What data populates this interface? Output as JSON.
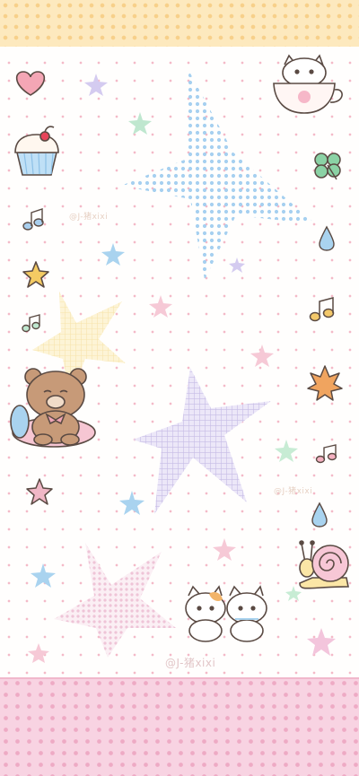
{
  "wallpaper": {
    "watermarks": [
      "@J-猪xixi",
      "@J-猪xixi",
      "@J-猪xixi"
    ],
    "palette": {
      "top_band": "#fde9be",
      "bottom_band": "#f8d3e2",
      "dot": "#f4b9c8",
      "blue_star": "#a9d3ef",
      "lavender_star": "#c9bfe6",
      "yellow_star": "#fbeab8",
      "pink_star": "#eec1d5"
    },
    "stickers": [
      "heart-icon",
      "cupcake-icon",
      "music-note-icon",
      "star-icon",
      "teacup-cat-icon",
      "clover-icon",
      "water-drop-icon",
      "teddy-bear-icon",
      "snail-icon",
      "two-kittens-icon",
      "maple-leaf-icon"
    ]
  }
}
